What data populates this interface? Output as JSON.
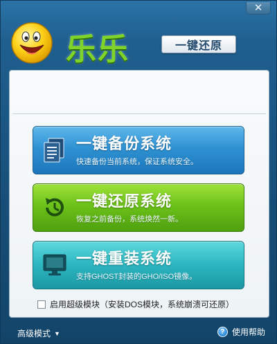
{
  "window": {
    "close_glyph": "✕"
  },
  "header": {
    "brand": "乐乐",
    "badge": "一键还原"
  },
  "actions": [
    {
      "title": "一键备份系统",
      "subtitle": "快速备份当前系统，保证系统安全。",
      "icon": "document-copy-icon",
      "color": "#2f92d3"
    },
    {
      "title": "一键还原系统",
      "subtitle": "恢复之前备份，系统焕然一新。",
      "icon": "history-restore-icon",
      "color": "#6cc21a"
    },
    {
      "title": "一键重装系统",
      "subtitle": "支持GHOST封装的GHO/ISO镜像。",
      "icon": "monitor-icon",
      "color": "#2fb9c3"
    }
  ],
  "option": {
    "label": "启用超级模块（安装DOS模块，系统崩溃可还原）",
    "checked": false
  },
  "footer": {
    "advanced_label": "高级模式",
    "help_label": "使用帮助",
    "help_glyph": "?"
  }
}
